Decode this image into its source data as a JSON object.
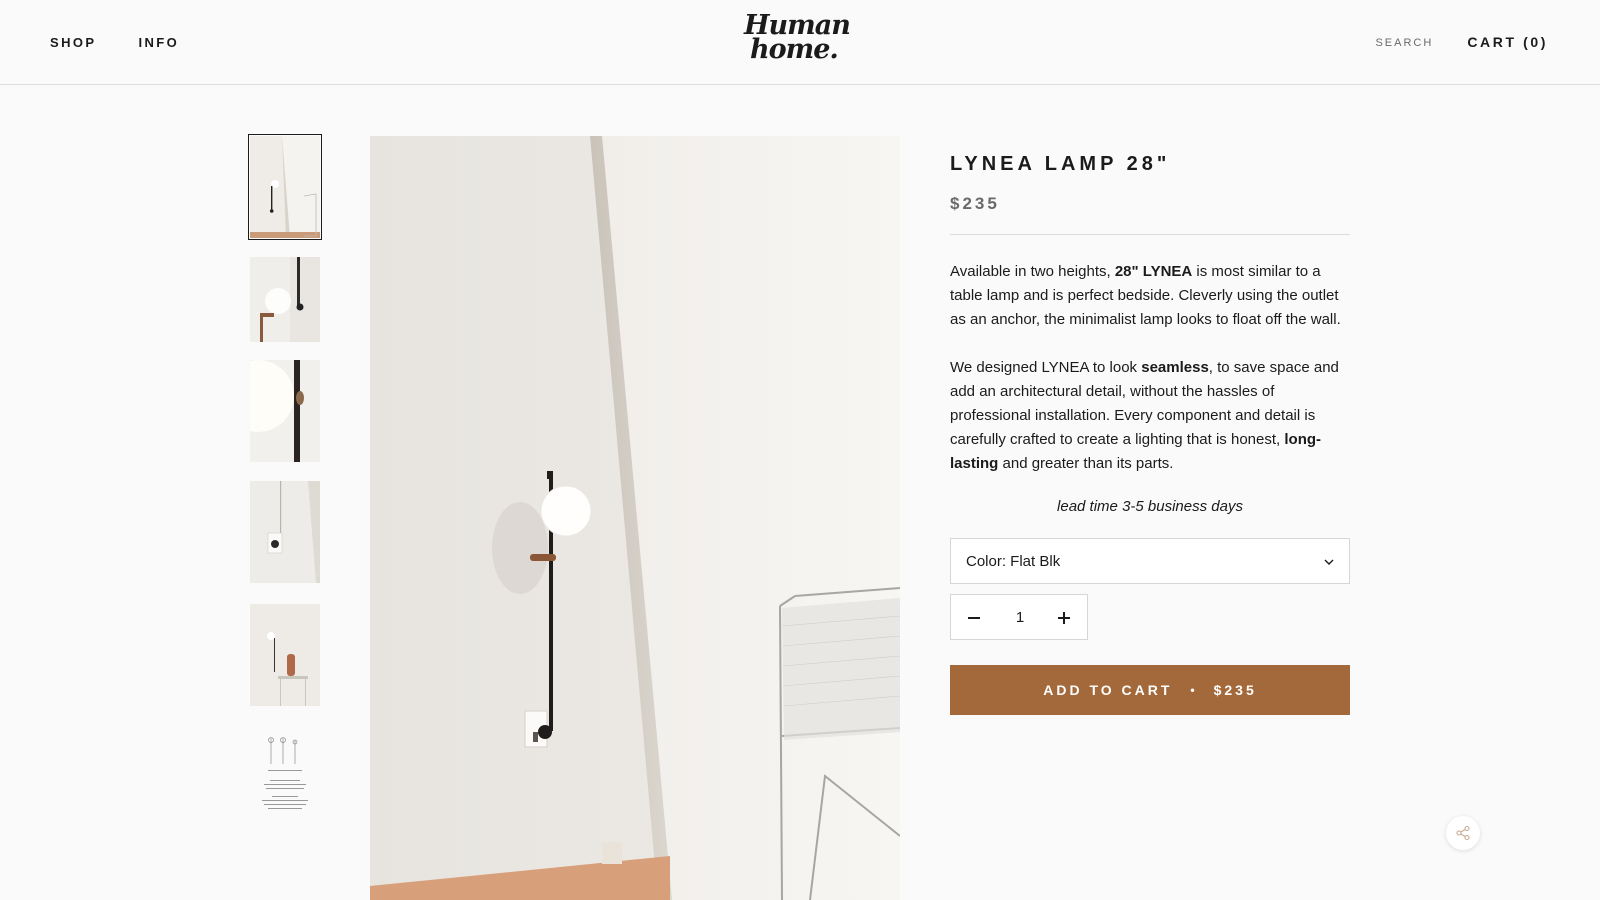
{
  "header": {
    "nav": [
      {
        "label": "SHOP"
      },
      {
        "label": "INFO"
      }
    ],
    "logo": {
      "line1": "Human",
      "line2": "home."
    },
    "search_label": "SEARCH",
    "cart_label": "CART (0)"
  },
  "gallery": {
    "thumbnail_count": 6,
    "active_index": 0
  },
  "product": {
    "title": "LYNEA LAMP 28\"",
    "price": "$235",
    "desc1": {
      "t1": "Available in two heights, ",
      "b1": "28\" LYNEA",
      "t2": " is most similar to a table lamp and is perfect bedside. Cleverly using the outlet as an anchor, the minimalist lamp looks to float off the wall."
    },
    "desc2": {
      "t1": "We designed LYNEA to look ",
      "b1": "seamless",
      "t2": ", to save space and add an architectural detail, without the hassles of professional installation. Every component and detail is carefully crafted to create a lighting that is honest, ",
      "b2": "long-lasting",
      "t3": " and greater than its parts."
    },
    "lead_time": "lead time 3-5 business days",
    "color_select": "Color: Flat Blk",
    "quantity": "1",
    "add_to_cart": {
      "label": "ADD TO CART",
      "separator": "•",
      "price": "$235"
    }
  },
  "colors": {
    "accent": "#a4693b",
    "text": "#1c1b1b",
    "muted": "#6a6a6a",
    "background": "#fafafa"
  }
}
